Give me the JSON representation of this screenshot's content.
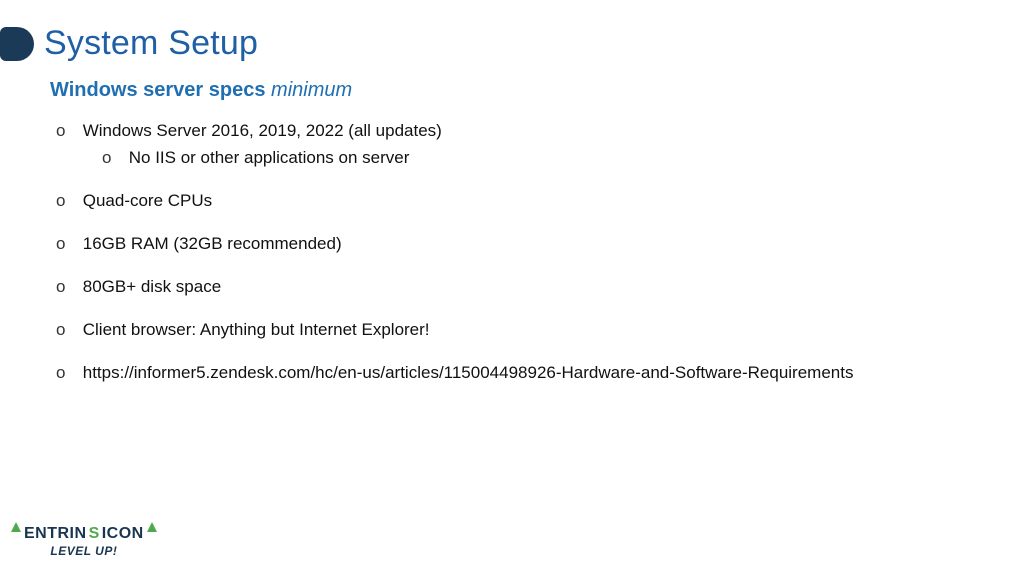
{
  "title": "System Setup",
  "subtitle": {
    "bold": "Windows server specs",
    "italic": "minimum"
  },
  "bullets": [
    {
      "text": "Windows Server 2016, 2019, 2022 (all updates)",
      "sub": [
        "No IIS or other applications on server"
      ]
    },
    {
      "text": "Quad-core CPUs"
    },
    {
      "text": "16GB RAM (32GB recommended)"
    },
    {
      "text": "80GB+ disk space"
    },
    {
      "text": "Client browser: Anything but Internet Explorer!"
    },
    {
      "text": "https://informer5.zendesk.com/hc/en-us/articles/115004498926-Hardware-and-Software-Requirements"
    }
  ],
  "logo": {
    "word_dark1": "ENTRIN",
    "word_green": "S",
    "word_dark2": "ICON",
    "level": "LEVEL UP!"
  }
}
